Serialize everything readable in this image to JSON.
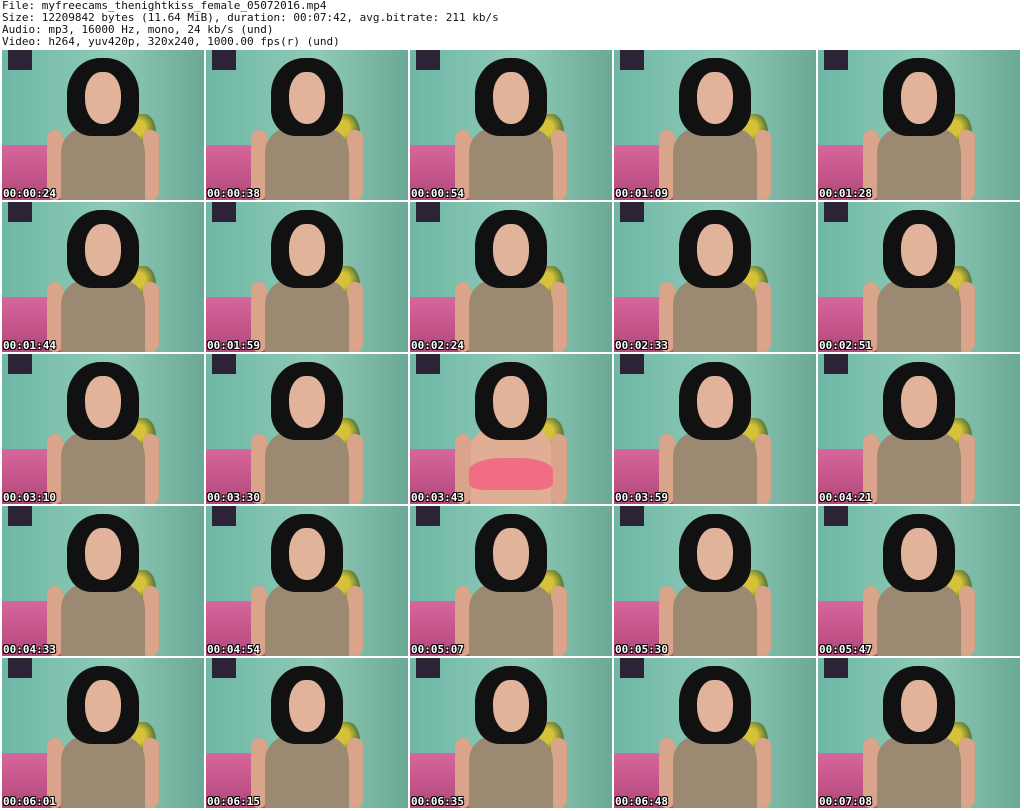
{
  "header": {
    "file": "File: myfreecams_thenightkiss_female_05072016.mp4",
    "size": "Size: 12209842 bytes (11.64 MiB), duration: 00:07:42, avg.bitrate: 211 kb/s",
    "audio": "Audio: mp3, 16000 Hz, mono, 24 kb/s (und)",
    "video": "Video: h264, yuv420p, 320x240, 1000.00 fps(r) (und)"
  },
  "thumbnails": [
    {
      "timestamp": "00:00:24"
    },
    {
      "timestamp": "00:00:38"
    },
    {
      "timestamp": "00:00:54"
    },
    {
      "timestamp": "00:01:09"
    },
    {
      "timestamp": "00:01:28"
    },
    {
      "timestamp": "00:01:44"
    },
    {
      "timestamp": "00:01:59"
    },
    {
      "timestamp": "00:02:24"
    },
    {
      "timestamp": "00:02:33"
    },
    {
      "timestamp": "00:02:51"
    },
    {
      "timestamp": "00:03:10"
    },
    {
      "timestamp": "00:03:30"
    },
    {
      "timestamp": "00:03:43"
    },
    {
      "timestamp": "00:03:59"
    },
    {
      "timestamp": "00:04:21"
    },
    {
      "timestamp": "00:04:33"
    },
    {
      "timestamp": "00:04:54"
    },
    {
      "timestamp": "00:05:07"
    },
    {
      "timestamp": "00:05:30"
    },
    {
      "timestamp": "00:05:47"
    },
    {
      "timestamp": "00:06:01"
    },
    {
      "timestamp": "00:06:15"
    },
    {
      "timestamp": "00:06:35"
    },
    {
      "timestamp": "00:06:48"
    },
    {
      "timestamp": "00:07:08"
    }
  ]
}
